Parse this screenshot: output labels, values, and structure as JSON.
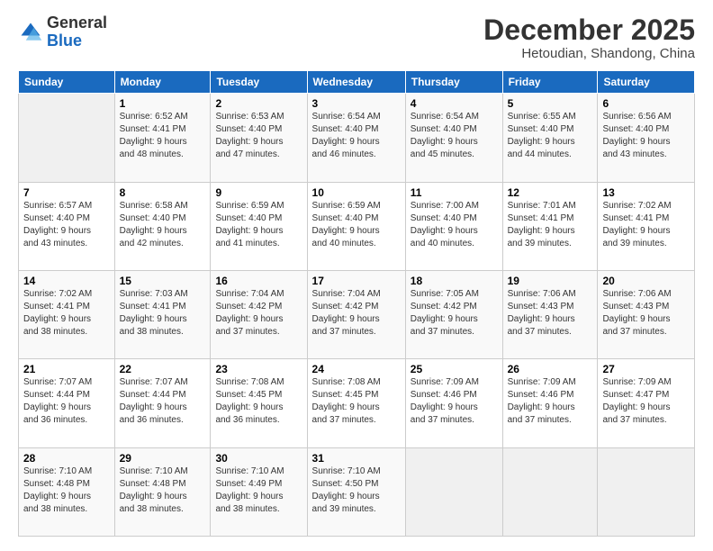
{
  "logo": {
    "general": "General",
    "blue": "Blue"
  },
  "header": {
    "month": "December 2025",
    "location": "Hetoudian, Shandong, China"
  },
  "days_of_week": [
    "Sunday",
    "Monday",
    "Tuesday",
    "Wednesday",
    "Thursday",
    "Friday",
    "Saturday"
  ],
  "weeks": [
    [
      {
        "day": "",
        "info": ""
      },
      {
        "day": "1",
        "info": "Sunrise: 6:52 AM\nSunset: 4:41 PM\nDaylight: 9 hours\nand 48 minutes."
      },
      {
        "day": "2",
        "info": "Sunrise: 6:53 AM\nSunset: 4:40 PM\nDaylight: 9 hours\nand 47 minutes."
      },
      {
        "day": "3",
        "info": "Sunrise: 6:54 AM\nSunset: 4:40 PM\nDaylight: 9 hours\nand 46 minutes."
      },
      {
        "day": "4",
        "info": "Sunrise: 6:54 AM\nSunset: 4:40 PM\nDaylight: 9 hours\nand 45 minutes."
      },
      {
        "day": "5",
        "info": "Sunrise: 6:55 AM\nSunset: 4:40 PM\nDaylight: 9 hours\nand 44 minutes."
      },
      {
        "day": "6",
        "info": "Sunrise: 6:56 AM\nSunset: 4:40 PM\nDaylight: 9 hours\nand 43 minutes."
      }
    ],
    [
      {
        "day": "7",
        "info": "Sunrise: 6:57 AM\nSunset: 4:40 PM\nDaylight: 9 hours\nand 43 minutes."
      },
      {
        "day": "8",
        "info": "Sunrise: 6:58 AM\nSunset: 4:40 PM\nDaylight: 9 hours\nand 42 minutes."
      },
      {
        "day": "9",
        "info": "Sunrise: 6:59 AM\nSunset: 4:40 PM\nDaylight: 9 hours\nand 41 minutes."
      },
      {
        "day": "10",
        "info": "Sunrise: 6:59 AM\nSunset: 4:40 PM\nDaylight: 9 hours\nand 40 minutes."
      },
      {
        "day": "11",
        "info": "Sunrise: 7:00 AM\nSunset: 4:40 PM\nDaylight: 9 hours\nand 40 minutes."
      },
      {
        "day": "12",
        "info": "Sunrise: 7:01 AM\nSunset: 4:41 PM\nDaylight: 9 hours\nand 39 minutes."
      },
      {
        "day": "13",
        "info": "Sunrise: 7:02 AM\nSunset: 4:41 PM\nDaylight: 9 hours\nand 39 minutes."
      }
    ],
    [
      {
        "day": "14",
        "info": "Sunrise: 7:02 AM\nSunset: 4:41 PM\nDaylight: 9 hours\nand 38 minutes."
      },
      {
        "day": "15",
        "info": "Sunrise: 7:03 AM\nSunset: 4:41 PM\nDaylight: 9 hours\nand 38 minutes."
      },
      {
        "day": "16",
        "info": "Sunrise: 7:04 AM\nSunset: 4:42 PM\nDaylight: 9 hours\nand 37 minutes."
      },
      {
        "day": "17",
        "info": "Sunrise: 7:04 AM\nSunset: 4:42 PM\nDaylight: 9 hours\nand 37 minutes."
      },
      {
        "day": "18",
        "info": "Sunrise: 7:05 AM\nSunset: 4:42 PM\nDaylight: 9 hours\nand 37 minutes."
      },
      {
        "day": "19",
        "info": "Sunrise: 7:06 AM\nSunset: 4:43 PM\nDaylight: 9 hours\nand 37 minutes."
      },
      {
        "day": "20",
        "info": "Sunrise: 7:06 AM\nSunset: 4:43 PM\nDaylight: 9 hours\nand 37 minutes."
      }
    ],
    [
      {
        "day": "21",
        "info": "Sunrise: 7:07 AM\nSunset: 4:44 PM\nDaylight: 9 hours\nand 36 minutes."
      },
      {
        "day": "22",
        "info": "Sunrise: 7:07 AM\nSunset: 4:44 PM\nDaylight: 9 hours\nand 36 minutes."
      },
      {
        "day": "23",
        "info": "Sunrise: 7:08 AM\nSunset: 4:45 PM\nDaylight: 9 hours\nand 36 minutes."
      },
      {
        "day": "24",
        "info": "Sunrise: 7:08 AM\nSunset: 4:45 PM\nDaylight: 9 hours\nand 37 minutes."
      },
      {
        "day": "25",
        "info": "Sunrise: 7:09 AM\nSunset: 4:46 PM\nDaylight: 9 hours\nand 37 minutes."
      },
      {
        "day": "26",
        "info": "Sunrise: 7:09 AM\nSunset: 4:46 PM\nDaylight: 9 hours\nand 37 minutes."
      },
      {
        "day": "27",
        "info": "Sunrise: 7:09 AM\nSunset: 4:47 PM\nDaylight: 9 hours\nand 37 minutes."
      }
    ],
    [
      {
        "day": "28",
        "info": "Sunrise: 7:10 AM\nSunset: 4:48 PM\nDaylight: 9 hours\nand 38 minutes."
      },
      {
        "day": "29",
        "info": "Sunrise: 7:10 AM\nSunset: 4:48 PM\nDaylight: 9 hours\nand 38 minutes."
      },
      {
        "day": "30",
        "info": "Sunrise: 7:10 AM\nSunset: 4:49 PM\nDaylight: 9 hours\nand 38 minutes."
      },
      {
        "day": "31",
        "info": "Sunrise: 7:10 AM\nSunset: 4:50 PM\nDaylight: 9 hours\nand 39 minutes."
      },
      {
        "day": "",
        "info": ""
      },
      {
        "day": "",
        "info": ""
      },
      {
        "day": "",
        "info": ""
      }
    ]
  ]
}
